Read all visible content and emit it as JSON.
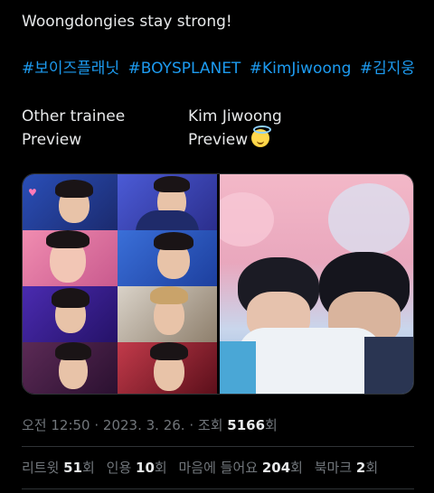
{
  "tweet": {
    "text": "Woongdongies stay strong!",
    "hashtags": [
      "#보이즈플래닛",
      "#BOYSPLANET",
      "#KimJiwoong",
      "#김지웅"
    ],
    "left_col": {
      "line1": "Other trainee",
      "line2": "Preview"
    },
    "right_col": {
      "line1": "Kim Jiwoong",
      "line2": "Preview",
      "emoji": "smiling-face-with-halo"
    }
  },
  "meta": {
    "time": "오전 12:50",
    "sep1": " · ",
    "date": "2023. 3. 26.",
    "sep2": " · ",
    "views_label": "조회 ",
    "views_count": "5166",
    "views_suffix": "회"
  },
  "stats": {
    "retweets_label": "리트윗 ",
    "retweets_count": "51",
    "retweets_suffix": "회",
    "quotes_label": "인용 ",
    "quotes_count": "10",
    "quotes_suffix": "회",
    "likes_label": "마음에 들어요 ",
    "likes_count": "204",
    "likes_suffix": "회",
    "bookmarks_label": "북마크 ",
    "bookmarks_count": "2",
    "bookmarks_suffix": "회"
  },
  "colors": {
    "link": "#1d9bf0",
    "muted": "#71767b",
    "text": "#e7e9ea",
    "background": "#000000"
  }
}
